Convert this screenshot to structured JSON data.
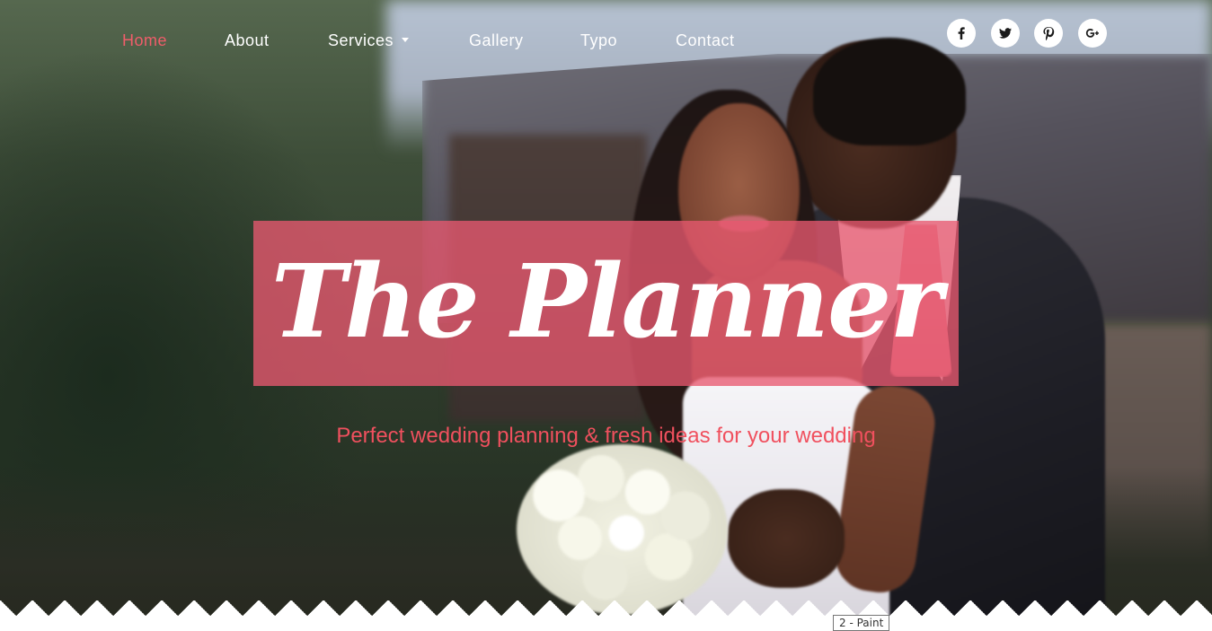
{
  "nav": {
    "items": [
      {
        "label": "Home",
        "active": true
      },
      {
        "label": "About",
        "active": false
      },
      {
        "label": "Services",
        "active": false,
        "has_dropdown": true
      },
      {
        "label": "Gallery",
        "active": false
      },
      {
        "label": "Typo",
        "active": false
      },
      {
        "label": "Contact",
        "active": false
      }
    ]
  },
  "social": {
    "items": [
      {
        "name": "facebook-icon",
        "glyph": "f"
      },
      {
        "name": "twitter-icon",
        "glyph": ""
      },
      {
        "name": "pinterest-icon",
        "glyph": "P"
      },
      {
        "name": "google-plus-icon",
        "glyph": "g+"
      }
    ]
  },
  "hero": {
    "title": "The Planner",
    "tagline": "Perfect wedding planning & fresh ideas for your wedding"
  },
  "taskbar_tooltip": "2 - Paint",
  "colors": {
    "accent": "#f05d6a",
    "banner": "#e85870",
    "nav_text": "#ffffff"
  }
}
